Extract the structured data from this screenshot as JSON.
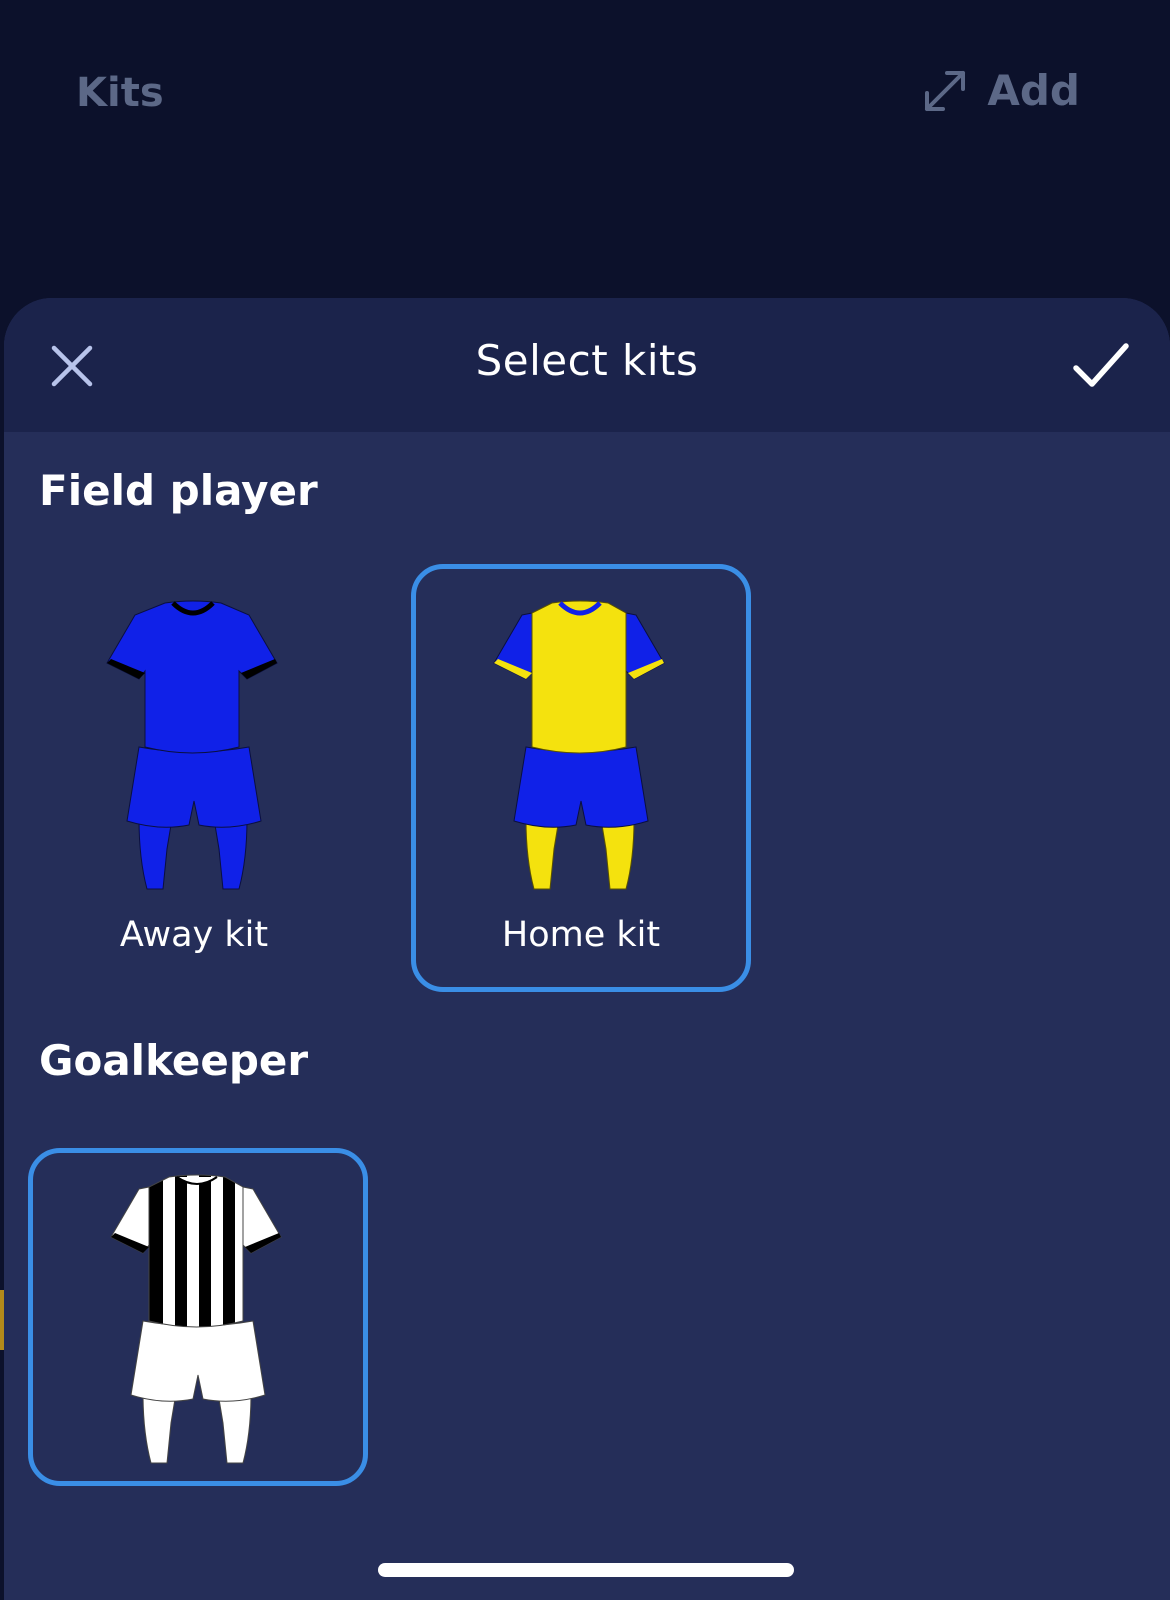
{
  "header": {
    "title": "Kits",
    "add_label": "Add"
  },
  "sheet": {
    "title": "Select kits"
  },
  "sections": {
    "field_player": {
      "title": "Field player",
      "kits": [
        {
          "label": "Away kit",
          "selected": false,
          "shirt": "#1021e8",
          "sleeves": "#1021e8",
          "shorts": "#1021e8",
          "socks": "#1021e8",
          "trim": "#000000"
        },
        {
          "label": "Home kit",
          "selected": true,
          "shirt": "#f4e20e",
          "sleeves": "#1021e8",
          "shorts": "#1021e8",
          "socks": "#f4e20e",
          "trim": "#f4e20e"
        }
      ]
    },
    "goalkeeper": {
      "title": "Goalkeeper",
      "kits": [
        {
          "label": "",
          "selected": true,
          "shirt": "#ffffff",
          "stripes": "#000000",
          "shorts": "#ffffff",
          "socks": "#ffffff",
          "trim": "#000000"
        }
      ]
    }
  },
  "colors": {
    "background": "#0c112b",
    "sheet": "#252e59",
    "sheet_header": "#1b234b",
    "selection_border": "#3a8ee6",
    "muted_text": "#5c6887"
  },
  "icons": {
    "close": "close-icon",
    "confirm": "checkmark-icon",
    "expand": "expand-arrows-icon"
  }
}
